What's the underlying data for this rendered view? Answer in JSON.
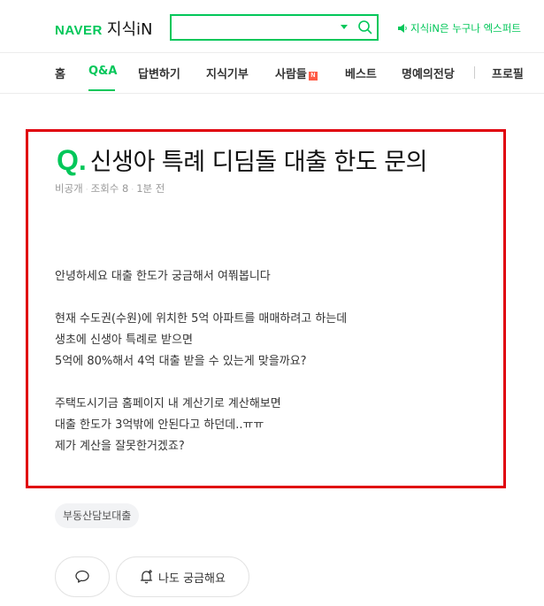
{
  "header": {
    "logo_naver": "NAVER",
    "logo_service": "지식iN",
    "search_value": "",
    "promo_text": "지식iN은 누구나 엑스퍼트"
  },
  "nav": {
    "items": [
      {
        "label": "홈"
      },
      {
        "label": "Q&A"
      },
      {
        "label": "답변하기"
      },
      {
        "label": "지식기부"
      },
      {
        "label": "사람들"
      },
      {
        "label": "베스트"
      },
      {
        "label": "명예의전당"
      },
      {
        "label": "프로필"
      }
    ],
    "active": "Q&A",
    "new_badge": "N"
  },
  "question": {
    "q_mark": "Q.",
    "title": "신생아 특례 디딤돌 대출 한도 문의",
    "meta": {
      "visibility": "비공개",
      "views": "조회수 8",
      "time": "1분 전"
    },
    "body_lines": [
      "안녕하세요 대출 한도가 궁금해서 여쭤봅니다",
      "",
      "현재 수도권(수원)에 위치한 5억 아파트를 매매하려고 하는데",
      "생초에 신생아 특례로 받으면",
      "5억에 80%해서 4억 대출 받을 수 있는게 맞을까요?",
      "",
      "주택도시기금 홈페이지 내 계산기로 계산해보면",
      "대출 한도가 3억밖에 안된다고 하던데..ㅠㅠ",
      "제가 계산을 잘못한거겠죠?"
    ]
  },
  "tags": [
    "부동산담보대출"
  ],
  "actions": {
    "curious_label": "나도 궁금해요"
  },
  "colors": {
    "brand": "#03c75a",
    "highlight_border": "#e0000c"
  }
}
